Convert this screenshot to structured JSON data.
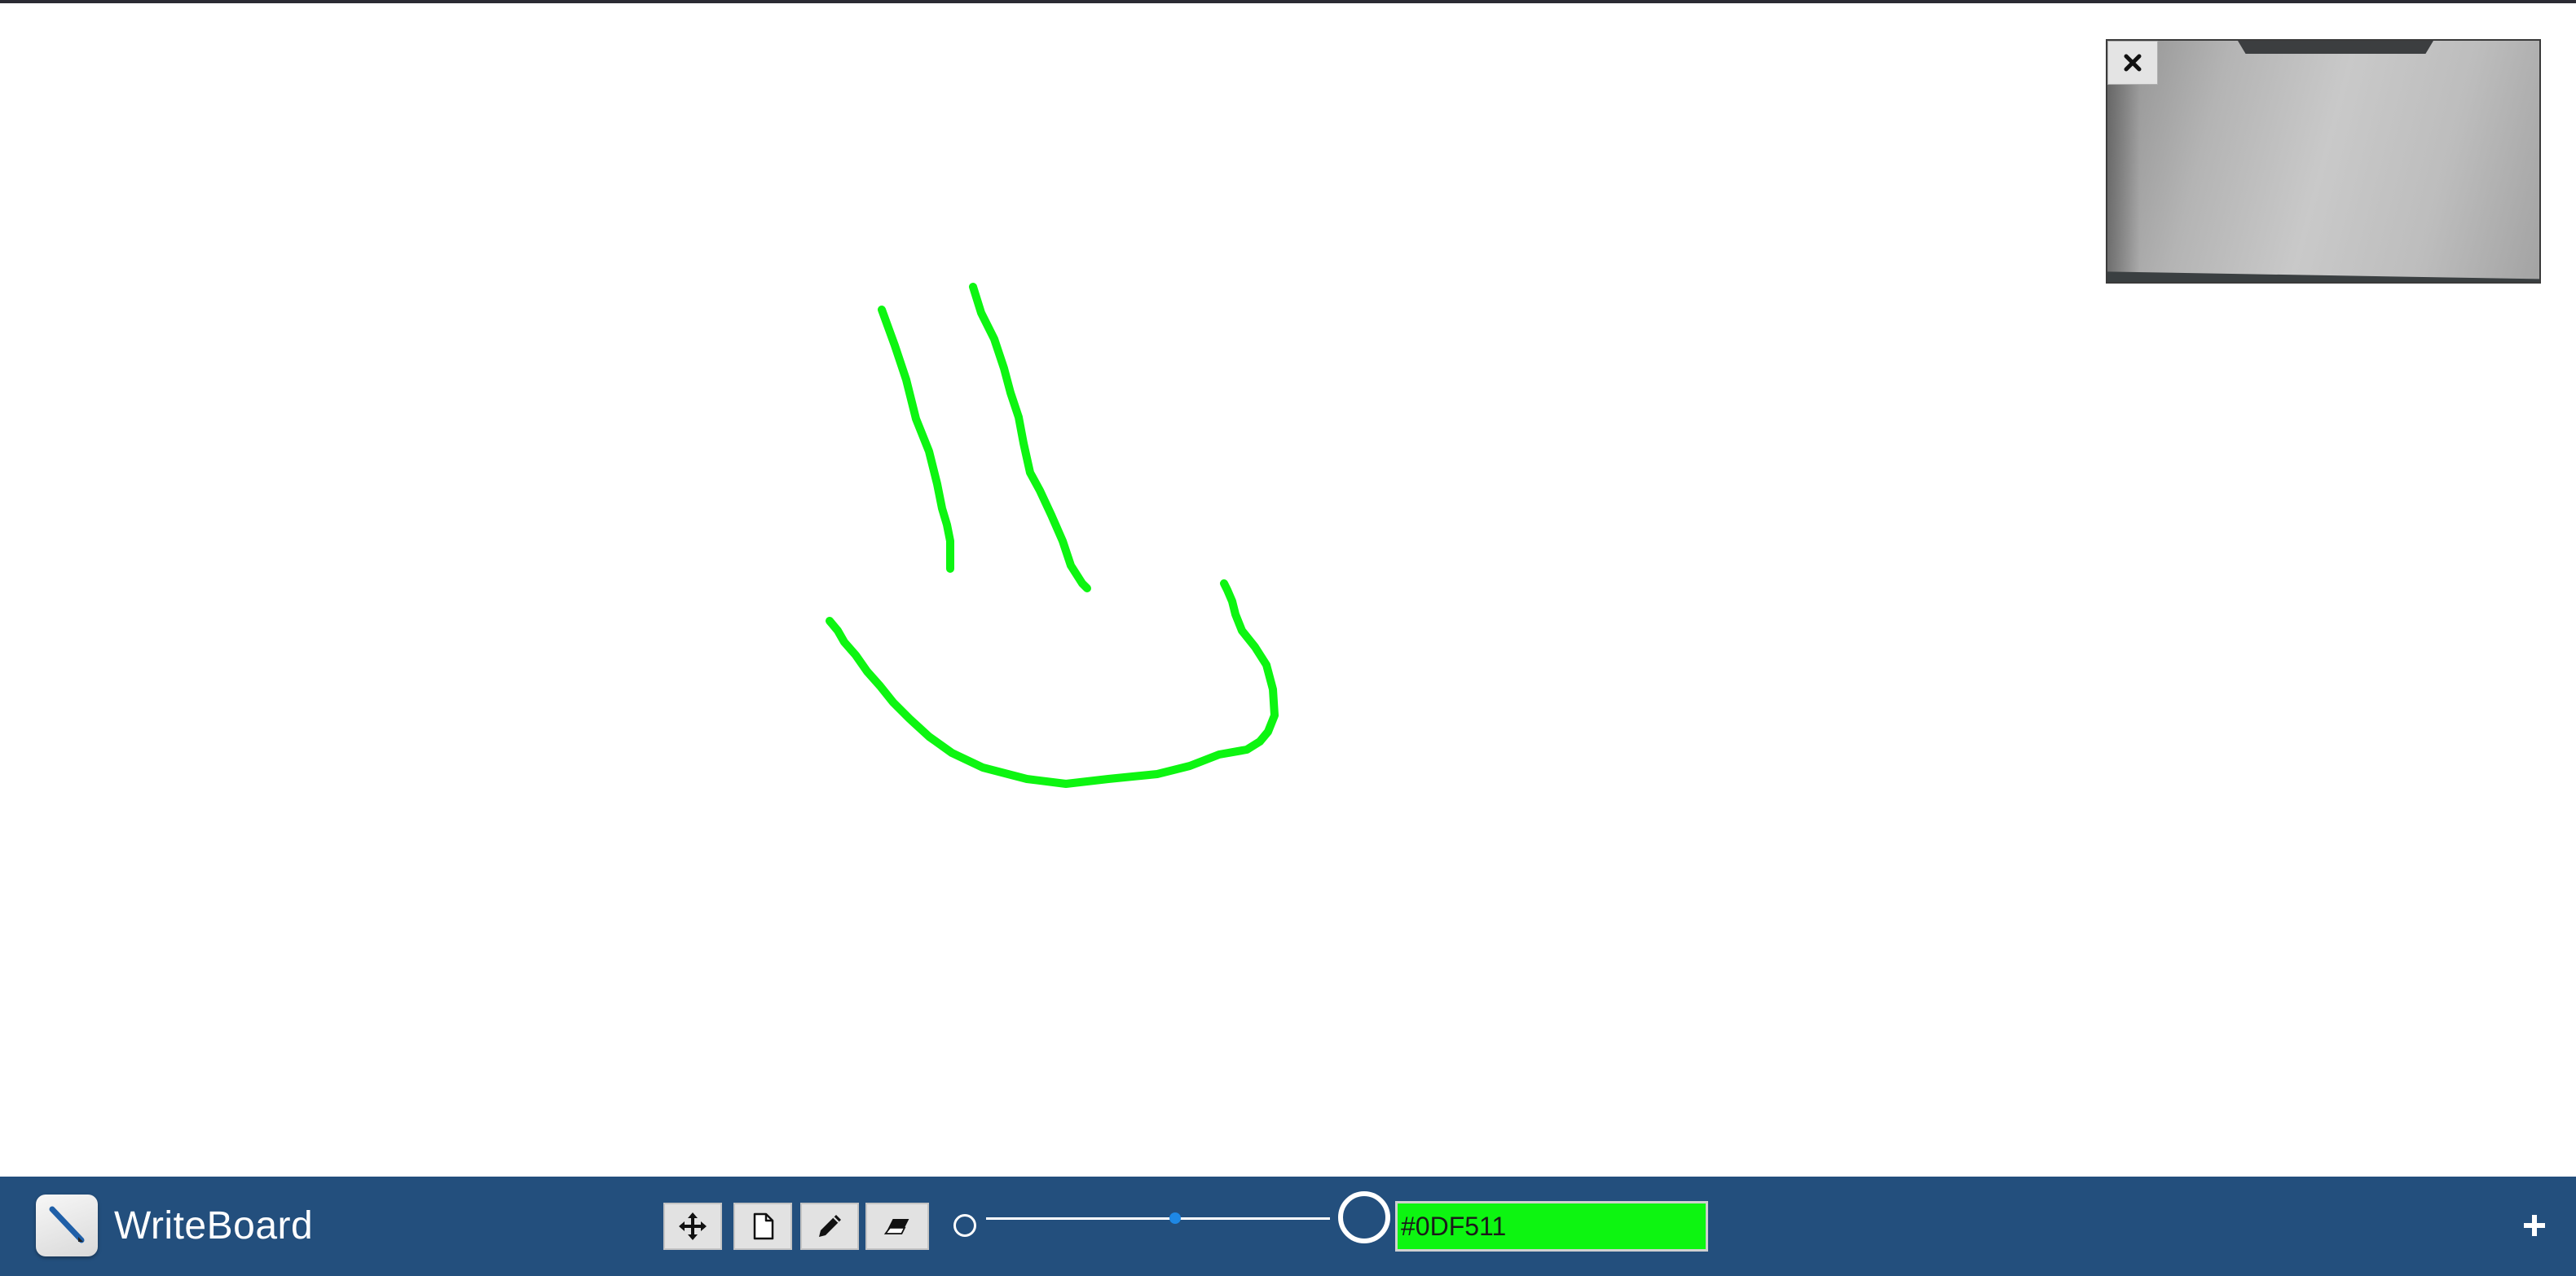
{
  "app": {
    "title": "WriteBoard",
    "logo_icon": "pen-icon"
  },
  "canvas": {
    "background": "#ffffff",
    "stroke_color": "#0DF511",
    "strokes_count": 3
  },
  "webcam": {
    "close_icon": "close-icon"
  },
  "toolbar": {
    "background": "#234f7d",
    "tools": [
      {
        "name": "move",
        "icon": "move-arrows-icon"
      },
      {
        "name": "new-page",
        "icon": "page-icon"
      },
      {
        "name": "pen",
        "icon": "pencil-icon"
      },
      {
        "name": "eraser",
        "icon": "eraser-icon"
      }
    ],
    "brush_size": {
      "min_icon": "small-circle-icon",
      "max_icon": "large-circle-icon",
      "value_fraction": 0.55
    },
    "color": {
      "value": "#0DF511",
      "fill": "#0df511"
    },
    "add_icon": "plus-icon"
  }
}
